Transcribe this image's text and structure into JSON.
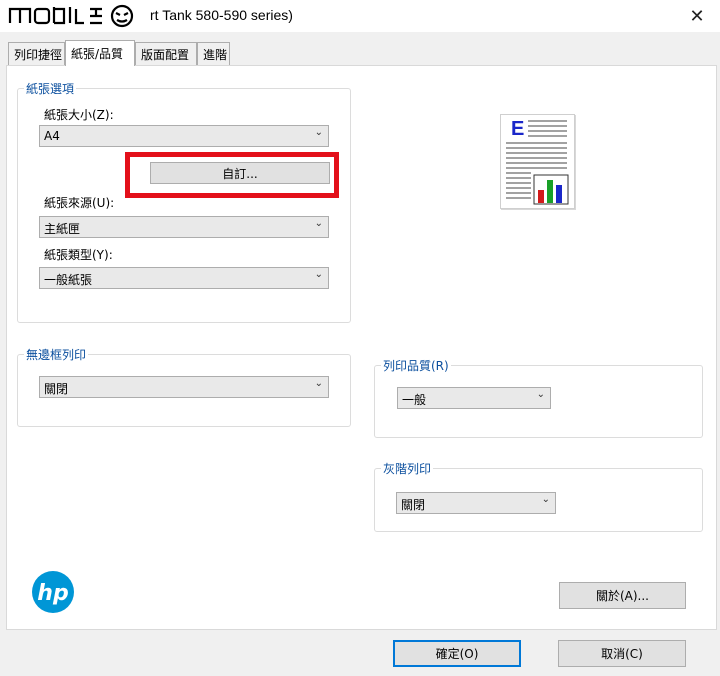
{
  "window": {
    "title": "rt Tank 580-590 series)",
    "close_glyph": "✕"
  },
  "tabs": [
    {
      "label": "列印捷徑",
      "active": false
    },
    {
      "label": "紙張/品質",
      "active": true
    },
    {
      "label": "版面配置",
      "active": false
    },
    {
      "label": "進階",
      "active": false
    }
  ],
  "paper_options": {
    "group_label": "紙張選項",
    "size_label": "紙張大小(Z):",
    "size_value": "A4",
    "custom_button": "自訂...",
    "source_label": "紙張來源(U):",
    "source_value": "主紙匣",
    "type_label": "紙張類型(Y):",
    "type_value": "一般紙張"
  },
  "borderless": {
    "group_label": "無邊框列印",
    "value": "關閉"
  },
  "print_quality": {
    "group_label": "列印品質(R)",
    "value": "一般"
  },
  "grayscale": {
    "group_label": "灰階列印",
    "value": "關閉"
  },
  "buttons": {
    "about": "關於(A)...",
    "ok": "確定(O)",
    "cancel": "取消(C)"
  },
  "preview": {
    "letter": "E"
  },
  "colors": {
    "highlight": "#e3101a",
    "group_label": "#0b4f9e",
    "hp_blue": "#0096d6"
  },
  "icons": {
    "dropdown": "chevron-down-icon",
    "brand": "hp-logo",
    "watermark": "mobile01-logo"
  }
}
